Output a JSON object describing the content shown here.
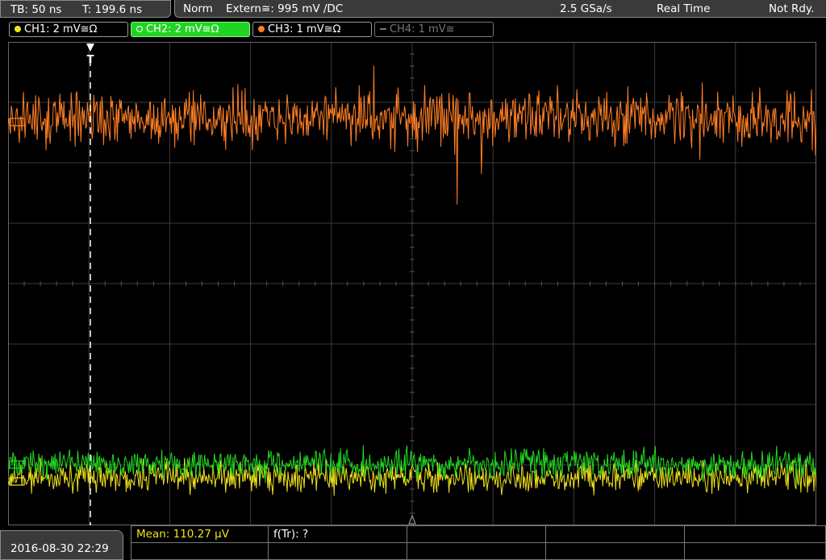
{
  "status_bar": {
    "timebase": "TB: 50 ns",
    "trigger_time": "T: 199.6 ns",
    "trigger_mode": "Norm",
    "trigger_source": "Extern≅: 995 mV ∕DC",
    "sample_rate": "2.5 GSa/s",
    "acq_mode": "Real Time",
    "status": "Not Rdy."
  },
  "channels": [
    {
      "label": "CH1: 2 mV≅Ω",
      "color": "#f0e21a",
      "active": true
    },
    {
      "label": "CH2: 2 mV≅Ω",
      "color": "#2ee62e",
      "active": true,
      "selected": true
    },
    {
      "label": "CH3: 1 mV≅Ω",
      "color": "#ff7f24",
      "active": true
    },
    {
      "label": "CH4: 1 mV≅",
      "color": "#777777",
      "active": false
    }
  ],
  "colors": {
    "ch1": "#f0e21a",
    "ch2": "#22d822",
    "ch3": "#ff7f24",
    "grid": "#3a3a3a",
    "trigger": "#ffffff"
  },
  "trigger_marker": "T",
  "measurements": {
    "mean": "Mean: 110.27 µV",
    "freq": "f(Tr): ?"
  },
  "datetime": "2016-08-30 22:29"
}
